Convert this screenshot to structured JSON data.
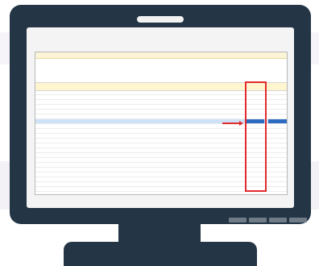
{
  "colors": {
    "bezel": "#243646",
    "screen_bg": "#f4f4f4",
    "highlight_row": "#cfe1f7",
    "selected_cell": "#2e6cc2",
    "annotation_red": "#e12b2f",
    "header_yellow": "#fff6cf"
  },
  "annotations": {
    "box": "red-highlight-box",
    "arrow": "red-arrow"
  }
}
